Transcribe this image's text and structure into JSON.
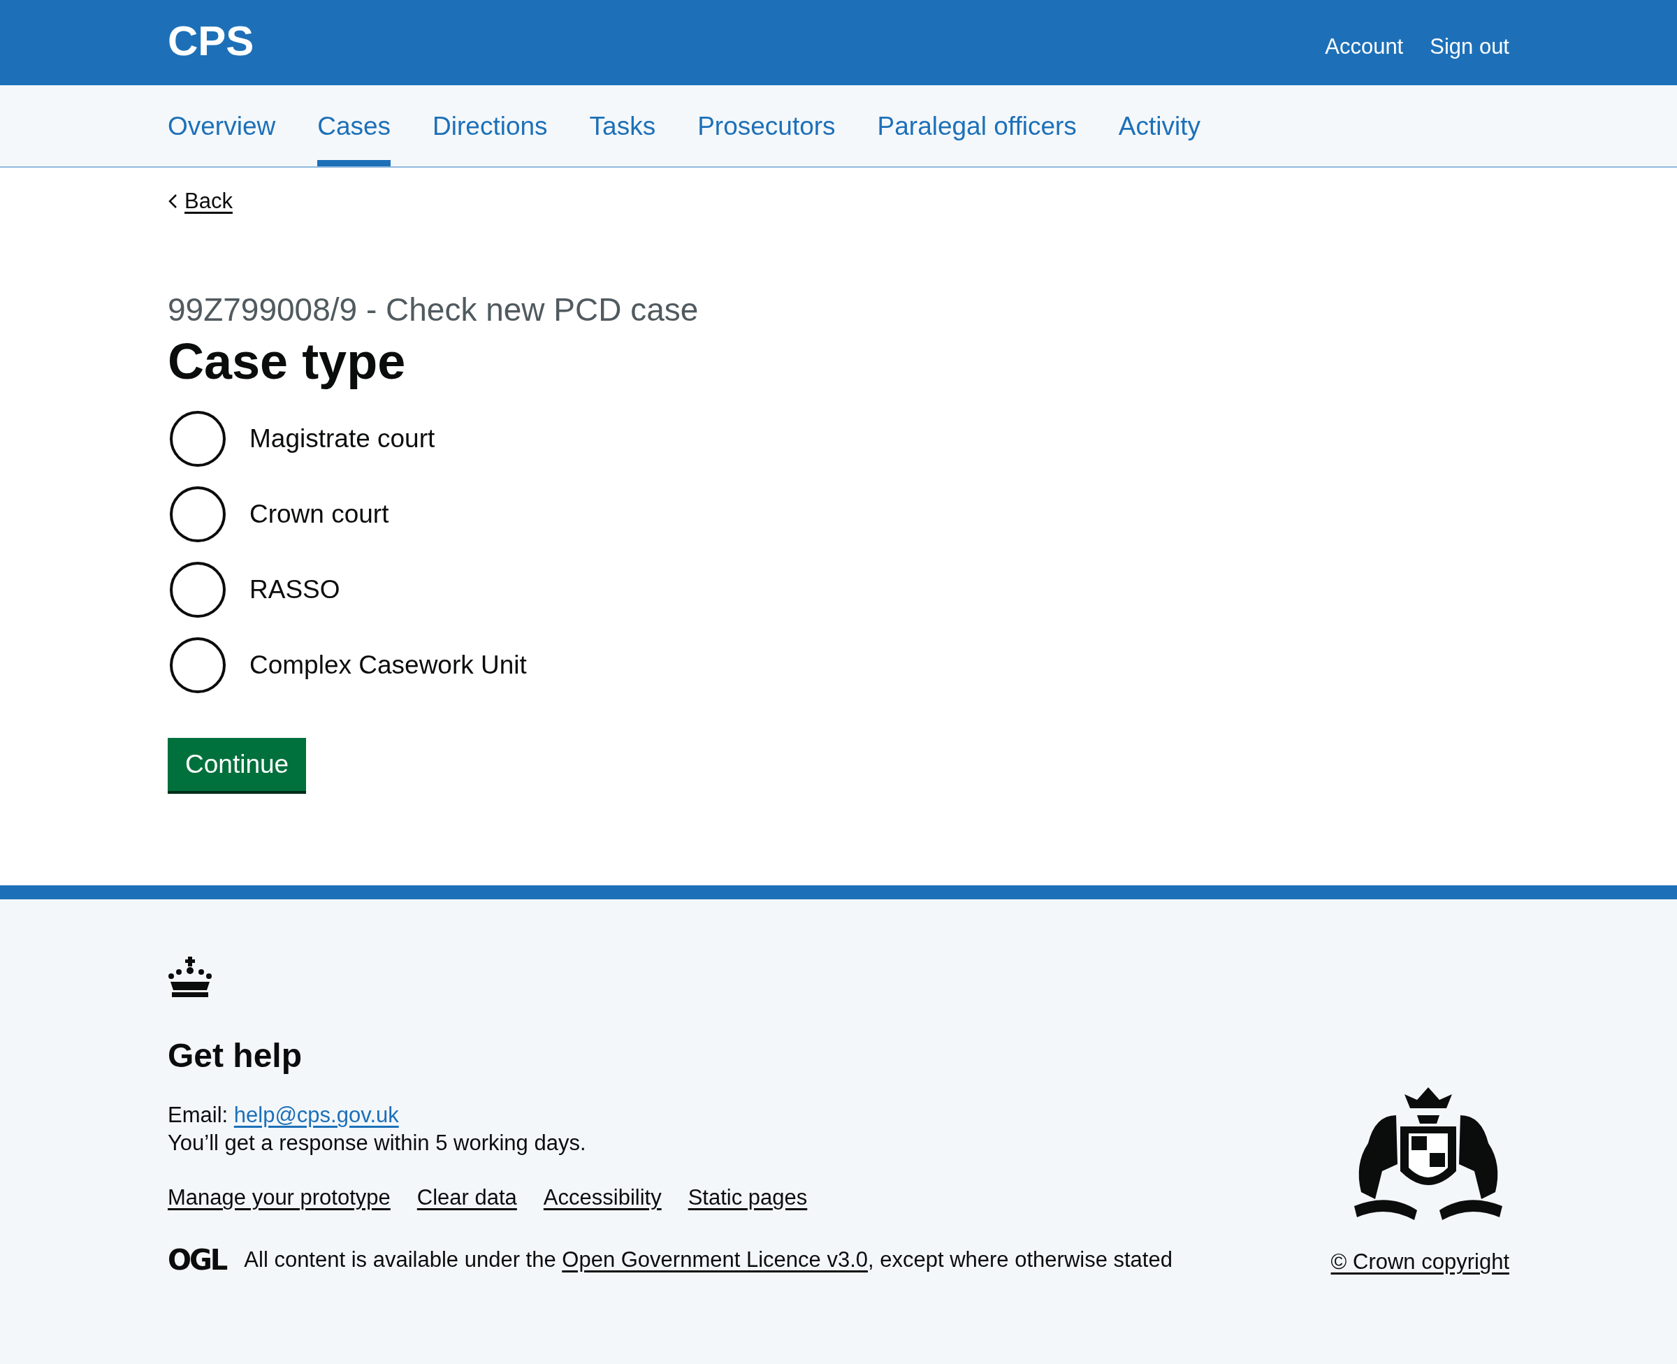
{
  "header": {
    "service_name": "CPS",
    "links": [
      "Account",
      "Sign out"
    ]
  },
  "navigation": [
    {
      "label": "Overview",
      "selected": false
    },
    {
      "label": "Cases",
      "selected": true
    },
    {
      "label": "Directions",
      "selected": false
    },
    {
      "label": "Tasks",
      "selected": false
    },
    {
      "label": "Prosecutors",
      "selected": false
    },
    {
      "label": "Paralegal officers",
      "selected": false
    },
    {
      "label": "Activity",
      "selected": false
    }
  ],
  "back_link": "Back",
  "caption": "99Z799008/9 - Check new PCD case",
  "heading": "Case type",
  "options": [
    {
      "label": "Magistrate court",
      "selected": false
    },
    {
      "label": "Crown court",
      "selected": false
    },
    {
      "label": "RASSO",
      "selected": false
    },
    {
      "label": "Complex Casework Unit",
      "selected": false
    }
  ],
  "button": "Continue",
  "footer": {
    "heading": "Get help",
    "email_label": "Email:",
    "email": "help@cps.gov.uk",
    "response_note": "You’ll get a response within 5 working days.",
    "links": [
      "Manage your prototype",
      "Clear data",
      "Accessibility",
      "Static pages"
    ],
    "licence_logo": "OGL",
    "licence_before": "All content is available under the",
    "licence_link": "Open Government Licence v3.0",
    "licence_after": ", except where otherwise stated",
    "copyright": "© Crown copyright"
  }
}
